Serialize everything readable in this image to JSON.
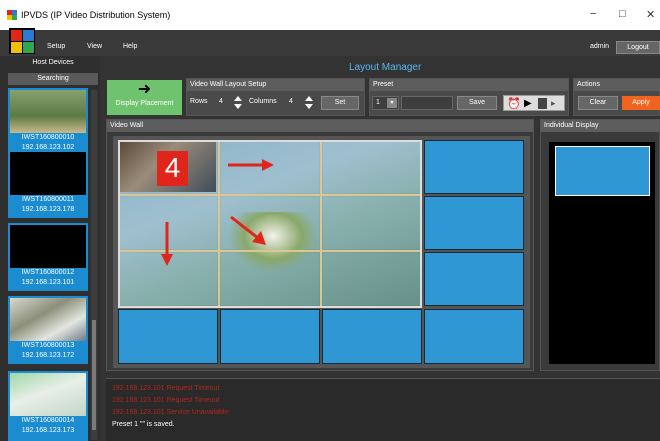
{
  "window": {
    "title": "IPVDS (IP Video Distribution System)",
    "minimize": "−",
    "maximize": "□",
    "close": "✕"
  },
  "menu": {
    "setup": "Setup",
    "view": "View",
    "help": "Help",
    "user": "admin",
    "logout": "Logout"
  },
  "sidebar": {
    "title": "Host Devices",
    "searching": "Searching",
    "devices": [
      {
        "name": "IWST160800010",
        "ip": "192.168.123.102"
      },
      {
        "name": "IWST160800011",
        "ip": "192.168.123.178"
      },
      {
        "name": "IWST160800012",
        "ip": "192.168.123.101"
      },
      {
        "name": "IWST160800013",
        "ip": "192.168.123.172"
      },
      {
        "name": "IWST160800014",
        "ip": "192.168.123.173"
      }
    ]
  },
  "layout_manager": {
    "title": "Layout Manager",
    "display_placement": "Display Placement",
    "setup": {
      "title": "Video Wall Layout Setup",
      "rows_label": "Rows",
      "rows": "4",
      "columns_label": "Columns",
      "columns": "4",
      "set": "Set"
    },
    "preset": {
      "title": "Preset",
      "value": "1",
      "save": "Save"
    },
    "actions": {
      "title": "Actions",
      "clear": "Clear",
      "apply": "Apply"
    },
    "video_wall": {
      "title": "Video Wall",
      "selected_number": "4"
    },
    "individual_display": {
      "title": "Individual Display"
    }
  },
  "log": [
    "192.168.123.101 Request Timeout",
    "192.168.123.101 Request Timeout",
    "192.168.123.101 Service Unavailable",
    "Preset 1 \"\" is saved."
  ],
  "colors": {
    "accent": "#2f97d4",
    "apply": "#f0641e",
    "placement": "#6fc36f",
    "log_error": "#b3261e",
    "number_badge": "#e0261a"
  }
}
